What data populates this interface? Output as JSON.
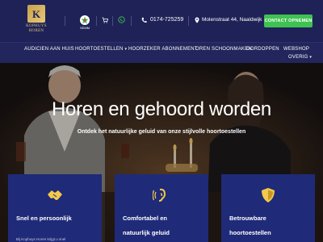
{
  "brand": {
    "logo_letter": "K",
    "name_line1": "KOPHUYS",
    "name_line2": "HOREN"
  },
  "topbar": {
    "seal_label": "SEMM",
    "phone": "0174-725259",
    "address": "Molenstraat 44, Naaldwijk",
    "contact_button": "CONTACT OPNEMEN"
  },
  "nav": {
    "items": [
      "AUDICIEN AAN HUIS",
      "HOORTOESTELLEN",
      "HOORZEKER ABONNEMENT",
      "OREN SCHOONMAKEN",
      "OORDOPPEN",
      "WEBSHOP",
      "OVERIG"
    ]
  },
  "hero": {
    "title": "Horen en gehoord worden",
    "subtitle": "Ontdek het natuurlijke geluid van onze stijlvolle hoortoestellen"
  },
  "cards": [
    {
      "title_line1": "Snel en persoonlijk",
      "title_line2": "",
      "small": "Bij Kophuys Horen krijgt u snel"
    },
    {
      "title_line1": "Comfortabel en",
      "title_line2": "natuurlijk geluid",
      "small": ""
    },
    {
      "title_line1": "Betrouwbare",
      "title_line2": "hoortoestellen",
      "small": ""
    }
  ],
  "colors": {
    "topbar": "#1f2257",
    "accent_gold": "#d9c27a",
    "contact_green": "#3fc252",
    "card_blue": "#1f2a78"
  }
}
